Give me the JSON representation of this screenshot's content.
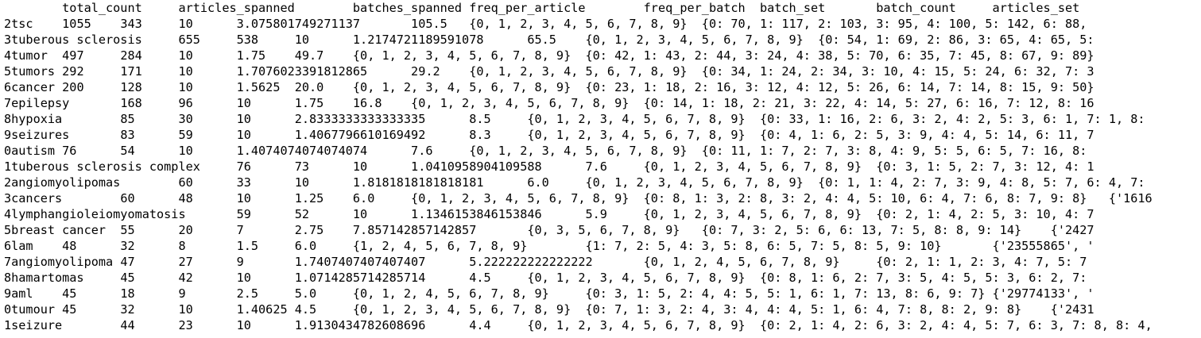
{
  "editor": {
    "lines": [
      "\ttotal_count\tarticles_spanned\tbatches_spanned\tfreq_per_article\tfreq_per_batch\tbatch_set\tbatch_count\tarticles_set",
      "2tsc\t1055\t343\t10\t3.075801749271137\t105.5\t{0, 1, 2, 3, 4, 5, 6, 7, 8, 9}\t{0: 70, 1: 117, 2: 103, 3: 95, 4: 100, 5: 142, 6: 88,",
      "3tuberous sclerosis\t655\t538\t10\t1.2174721189591078\t65.5\t{0, 1, 2, 3, 4, 5, 6, 7, 8, 9}\t{0: 54, 1: 69, 2: 86, 3: 65, 4: 65, 5:",
      "4tumor\t497\t284\t10\t1.75\t49.7\t{0, 1, 2, 3, 4, 5, 6, 7, 8, 9}\t{0: 42, 1: 43, 2: 44, 3: 24, 4: 38, 5: 70, 6: 35, 7: 45, 8: 67, 9: 89}",
      "5tumors\t292\t171\t10\t1.7076023391812865\t29.2\t{0, 1, 2, 3, 4, 5, 6, 7, 8, 9}\t{0: 34, 1: 24, 2: 34, 3: 10, 4: 15, 5: 24, 6: 32, 7: 3",
      "6cancer\t200\t128\t10\t1.5625\t20.0\t{0, 1, 2, 3, 4, 5, 6, 7, 8, 9}\t{0: 23, 1: 18, 2: 16, 3: 12, 4: 12, 5: 26, 6: 14, 7: 14, 8: 15, 9: 50}",
      "7epilepsy\t168\t96\t10\t1.75\t16.8\t{0, 1, 2, 3, 4, 5, 6, 7, 8, 9}\t{0: 14, 1: 18, 2: 21, 3: 22, 4: 14, 5: 27, 6: 16, 7: 12, 8: 16",
      "8hypoxia\t85\t30\t10\t2.8333333333333335\t8.5\t{0, 1, 2, 3, 4, 5, 6, 7, 8, 9}\t{0: 33, 1: 16, 2: 6, 3: 2, 4: 2, 5: 3, 6: 1, 7: 1, 8:",
      "9seizures\t83\t59\t10\t1.4067796610169492\t8.3\t{0, 1, 2, 3, 4, 5, 6, 7, 8, 9}\t{0: 4, 1: 6, 2: 5, 3: 9, 4: 4, 5: 14, 6: 11, 7",
      "0autism\t76\t54\t10\t1.4074074074074074\t7.6\t{0, 1, 2, 3, 4, 5, 6, 7, 8, 9}\t{0: 11, 1: 7, 2: 7, 3: 8, 4: 9, 5: 5, 6: 5, 7: 16, 8:",
      "1tuberous sclerosis complex\t76\t73\t10\t1.0410958904109588\t7.6\t{0, 1, 2, 3, 4, 5, 6, 7, 8, 9}\t{0: 3, 1: 5, 2: 7, 3: 12, 4: 1",
      "2angiomyolipomas\t60\t33\t10\t1.8181818181818181\t6.0\t{0, 1, 2, 3, 4, 5, 6, 7, 8, 9}\t{0: 1, 1: 4, 2: 7, 3: 9, 4: 8, 5: 7, 6: 4, 7:",
      "3cancers\t60\t48\t10\t1.25\t6.0\t{0, 1, 2, 3, 4, 5, 6, 7, 8, 9}\t{0: 8, 1: 3, 2: 8, 3: 2, 4: 4, 5: 10, 6: 4, 7: 6, 8: 7, 9: 8}\t{'1616",
      "4lymphangioleiomyomatosis\t59\t52\t10\t1.1346153846153846\t5.9\t{0, 1, 2, 3, 4, 5, 6, 7, 8, 9}\t{0: 2, 1: 4, 2: 5, 3: 10, 4: 7",
      "5breast cancer\t55\t20\t7\t2.75\t7.857142857142857\t{0, 3, 5, 6, 7, 8, 9}\t{0: 7, 3: 2, 5: 6, 6: 13, 7: 5, 8: 8, 9: 14}\t{'2427",
      "6lam\t48\t32\t8\t1.5\t6.0\t{1, 2, 4, 5, 6, 7, 8, 9}\t{1: 7, 2: 5, 4: 3, 5: 8, 6: 5, 7: 5, 8: 5, 9: 10}\t{'23555865', '",
      "7angiomyolipoma\t47\t27\t9\t1.7407407407407407\t5.222222222222222\t{0, 1, 2, 4, 5, 6, 7, 8, 9}\t{0: 2, 1: 1, 2: 3, 4: 7, 5: 7",
      "8hamartomas\t45\t42\t10\t1.0714285714285714\t4.5\t{0, 1, 2, 3, 4, 5, 6, 7, 8, 9}\t{0: 8, 1: 6, 2: 7, 3: 5, 4: 5, 5: 3, 6: 2, 7:",
      "9aml\t45\t18\t9\t2.5\t5.0\t{0, 1, 2, 4, 5, 6, 7, 8, 9}\t{0: 3, 1: 5, 2: 4, 4: 5, 5: 1, 6: 1, 7: 13, 8: 6, 9: 7}\t{'29774133', '",
      "0tumour\t45\t32\t10\t1.40625\t4.5\t{0, 1, 2, 3, 4, 5, 6, 7, 8, 9}\t{0: 7, 1: 3, 2: 4, 3: 4, 4: 4, 5: 1, 6: 4, 7: 8, 8: 2, 9: 8}\t{'2431",
      "1seizure\t44\t23\t10\t1.9130434782608696\t4.4\t{0, 1, 2, 3, 4, 5, 6, 7, 8, 9}\t{0: 2, 1: 4, 2: 6, 3: 2, 4: 4, 5: 7, 6: 3, 7: 8, 8: 4,"
    ]
  }
}
